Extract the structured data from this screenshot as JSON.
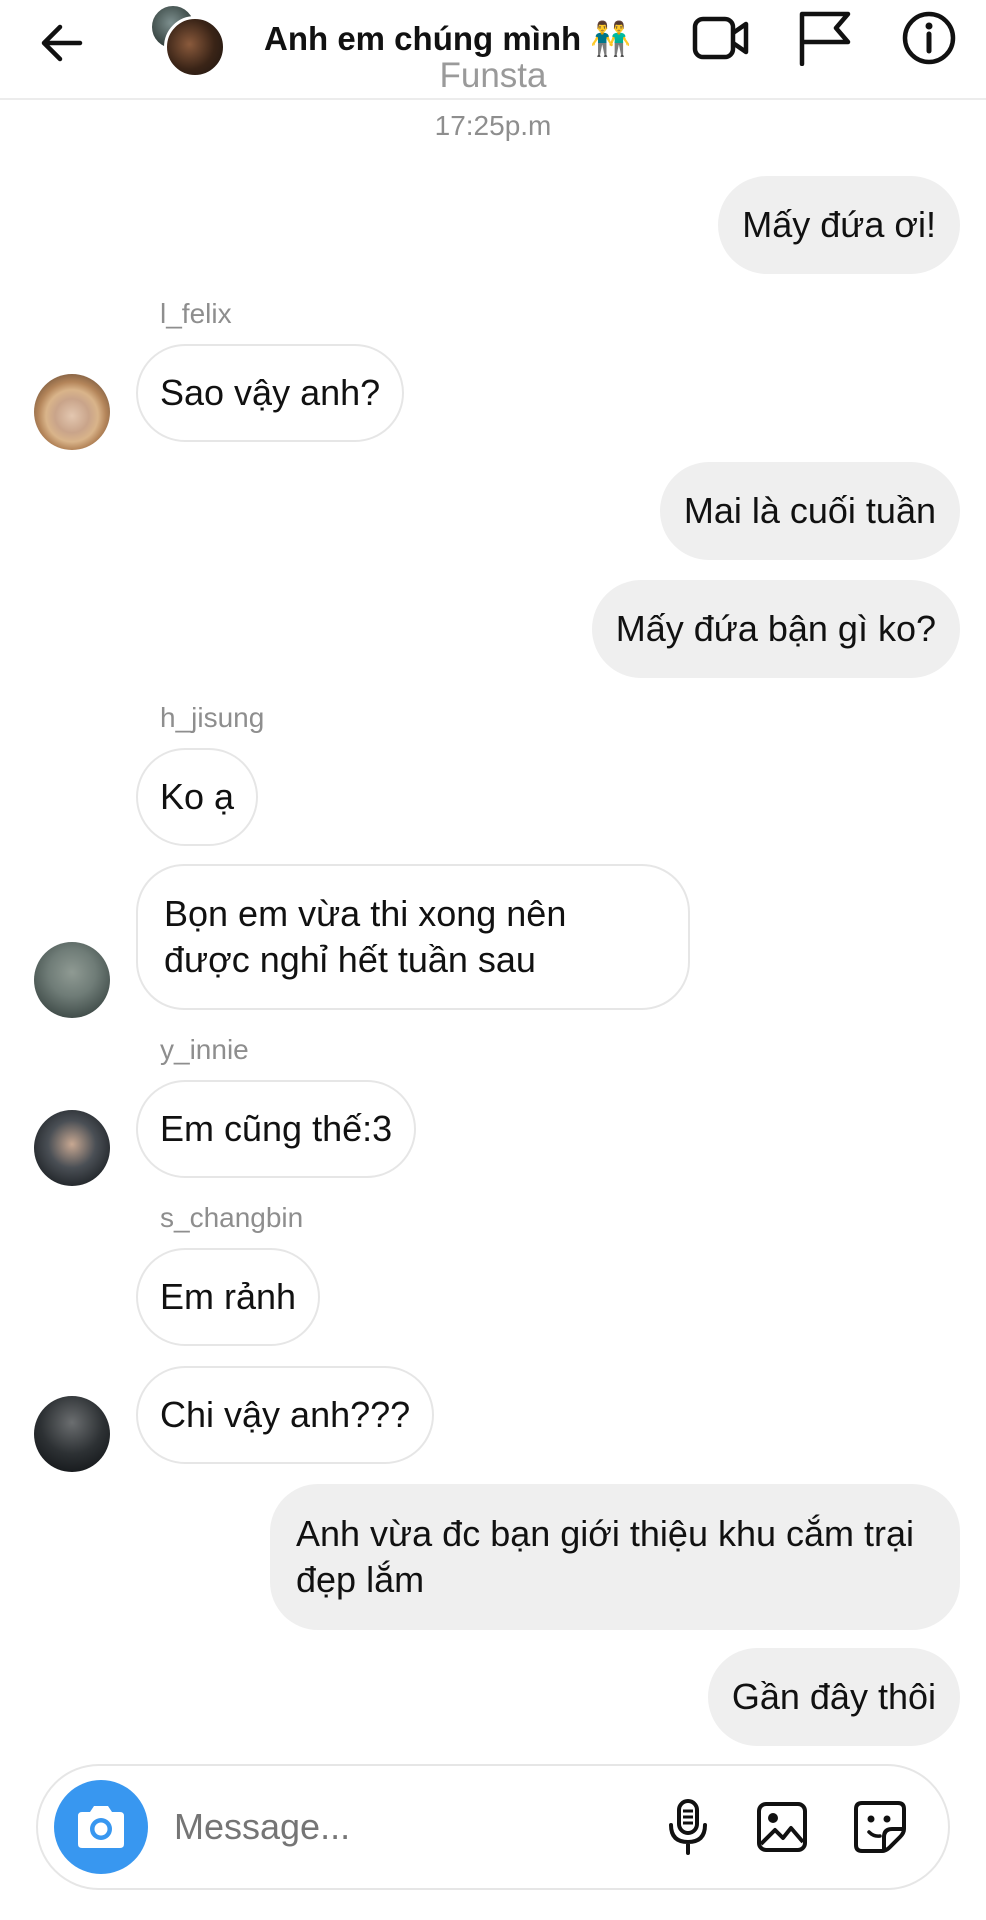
{
  "header": {
    "title": "Anh em chúng mình 👬",
    "subtitle": "Funsta",
    "back_icon": "arrow-left-icon",
    "icons": [
      "video-call-icon",
      "flag-icon",
      "info-icon"
    ]
  },
  "timestamp": "17:25p.m",
  "messages": [
    {
      "text": "Mấy đứa ơi!"
    },
    {
      "sender": "l_felix",
      "text": "Sao vậy anh?"
    },
    {
      "text": "Mai là cuối tuần"
    },
    {
      "text": "Mấy đứa bận gì ko?"
    },
    {
      "sender": "h_jisung",
      "text": "Ko ạ"
    },
    {
      "text": "Bọn em vừa thi xong nên được nghỉ hết tuần sau"
    },
    {
      "sender": "y_innie",
      "text": "Em cũng thế:3"
    },
    {
      "sender": "s_changbin",
      "text": "Em rảnh"
    },
    {
      "text": "Chi vậy anh???"
    },
    {
      "text": "Anh vừa đc bạn giới thiệu khu cắm trại đẹp lắm"
    },
    {
      "text": "Gần đây thôi"
    }
  ],
  "composer": {
    "placeholder": "Message...",
    "icons": [
      "camera-icon",
      "microphone-icon",
      "gallery-icon",
      "sticker-icon"
    ]
  },
  "colors": {
    "accent": "#3897f0",
    "outgoing_bubble": "#efefef",
    "muted_text": "#8e8e8e"
  }
}
